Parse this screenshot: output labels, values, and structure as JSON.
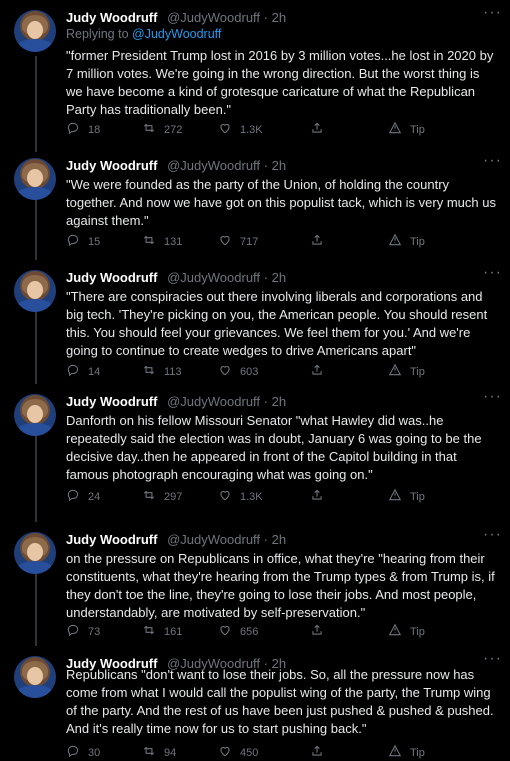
{
  "author": {
    "name": "Judy Woodruff",
    "handle": "@JudyWoodruff",
    "time": "2h"
  },
  "reply_prefix": "Replying to",
  "reply_to": "@JudyWoodruff",
  "tweets": [
    {
      "text": "\"former President Trump lost in 2016 by 3 million votes...he lost in 2020 by 7 million votes. We're going in the wrong direction. But the worst thing is we have become a kind of grotesque caricature of what the Republican Party has traditionally been.\"",
      "replies": "18",
      "retweets": "272",
      "likes": "1.3K",
      "tip": "Tip"
    },
    {
      "text": "\"We were founded as the party of the Union, of holding the country together. And now we have got on this populist tack, which is very much us against them.\"",
      "replies": "15",
      "retweets": "131",
      "likes": "717",
      "tip": "Tip"
    },
    {
      "text": "\"There are conspiracies out there involving liberals and corporations and big tech. 'They're picking on you, the American people. You should resent this. You should feel your grievances. We feel them for you.' And we're going to continue to create wedges to drive Americans apart\"",
      "replies": "14",
      "retweets": "113",
      "likes": "603",
      "tip": "Tip"
    },
    {
      "text": "Danforth on his fellow Missouri Senator \"what Hawley did was..he repeatedly said the election was in doubt, January 6 was going to be the decisive day..then he appeared in front of the Capitol building in that famous photograph encouraging what was going on.\"",
      "replies": "24",
      "retweets": "297",
      "likes": "1.3K",
      "tip": "Tip"
    },
    {
      "text": "on the pressure on Republicans in office, what they're \"hearing from their constituents, what they're hearing from the Trump types & from Trump is, if they don't toe the line, they're going to lose their jobs. And most people, understandably, are motivated by self-preservation.\"",
      "replies": "73",
      "retweets": "161",
      "likes": "656",
      "tip": "Tip"
    },
    {
      "text": "Republicans \"don't want to lose their jobs. So, all the pressure now has come from what I would call the populist wing of the party, the Trump wing of the party. And the rest of us have been just pushed & pushed & pushed. And it's really time now for us to start pushing back.\"",
      "replies": "30",
      "retweets": "94",
      "likes": "450",
      "tip": "Tip"
    }
  ],
  "icons": {
    "reply": "reply-icon",
    "retweet": "retweet-icon",
    "like": "heart-icon",
    "share": "share-icon",
    "tip": "tip-icon",
    "more": "more-icon"
  },
  "colors": {
    "background": "#000000",
    "text": "#e7e9ea",
    "muted": "#6e767d",
    "link": "#1d9bf0"
  }
}
